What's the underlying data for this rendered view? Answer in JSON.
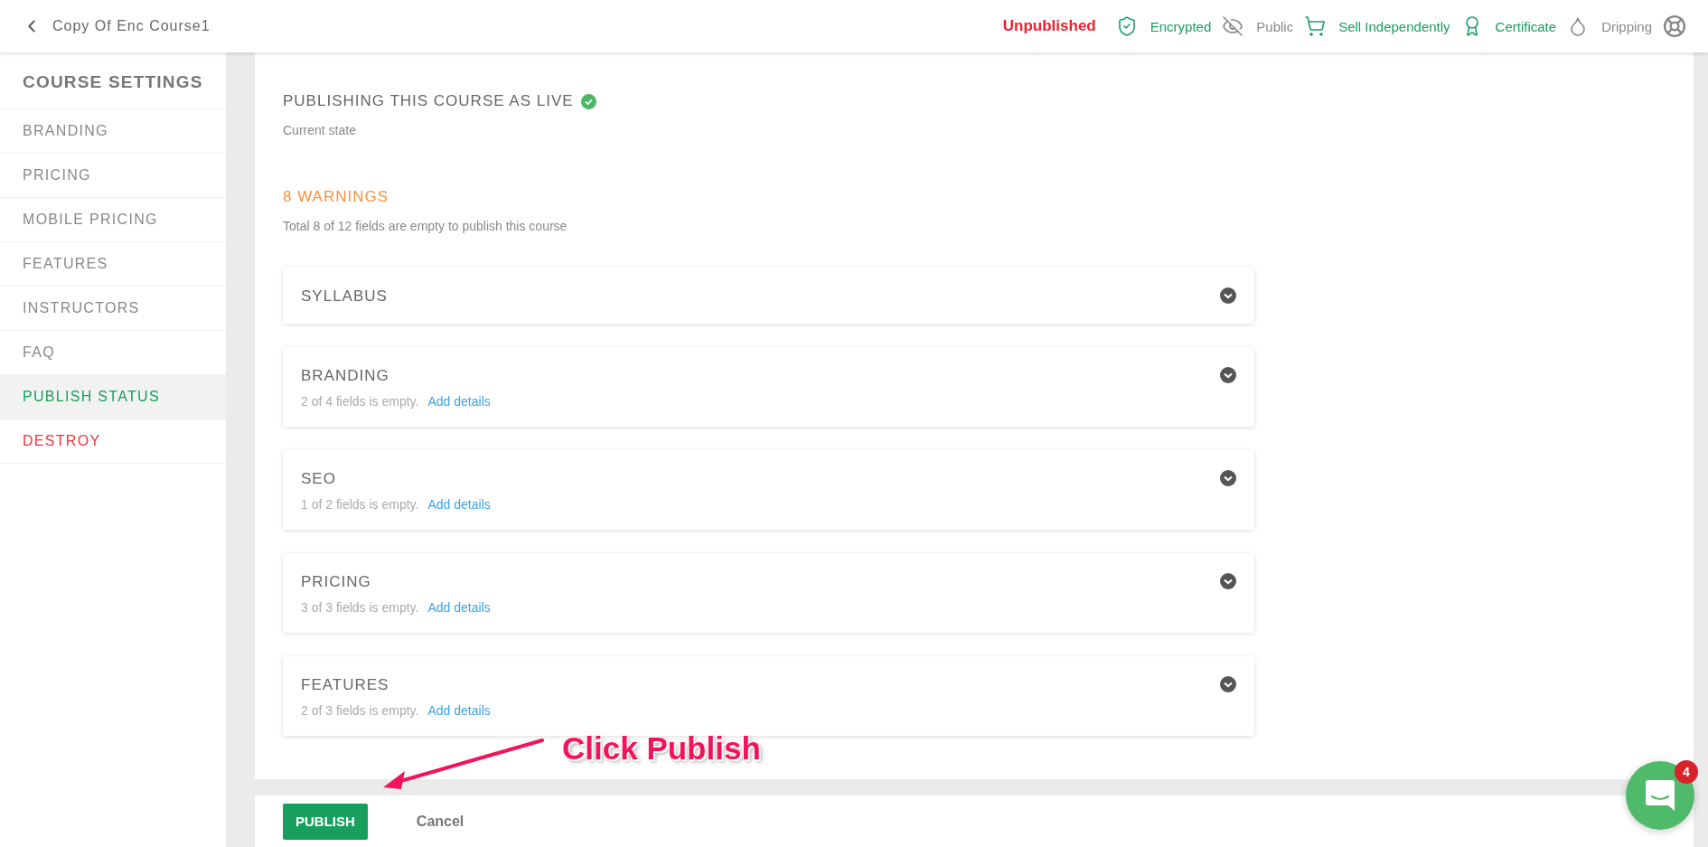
{
  "header": {
    "title": "Copy Of Enc Course1",
    "status": "Unpublished",
    "badges": [
      {
        "kind": "shield",
        "label": "Encrypted",
        "active": true
      },
      {
        "kind": "eye",
        "label": "Public",
        "active": false
      },
      {
        "kind": "cart",
        "label": "Sell Independently",
        "active": true
      },
      {
        "kind": "ribbon",
        "label": "Certificate",
        "active": true
      },
      {
        "kind": "drop",
        "label": "Dripping",
        "active": false
      }
    ]
  },
  "sidebar": {
    "title": "COURSE SETTINGS",
    "items": [
      {
        "label": "BRANDING",
        "selected": false,
        "kind": "normal"
      },
      {
        "label": "PRICING",
        "selected": false,
        "kind": "normal"
      },
      {
        "label": "MOBILE PRICING",
        "selected": false,
        "kind": "normal"
      },
      {
        "label": "FEATURES",
        "selected": false,
        "kind": "normal"
      },
      {
        "label": "INSTRUCTORS",
        "selected": false,
        "kind": "normal"
      },
      {
        "label": "FAQ",
        "selected": false,
        "kind": "normal"
      },
      {
        "label": "PUBLISH STATUS",
        "selected": true,
        "kind": "normal"
      },
      {
        "label": "DESTROY",
        "selected": false,
        "kind": "danger"
      }
    ]
  },
  "publish": {
    "heading": "PUBLISHING THIS COURSE AS LIVE",
    "verified": true,
    "caption": "Current state"
  },
  "warnings": {
    "title": "8 WARNINGS",
    "caption": "Total 8 of 12 fields are empty to publish this course"
  },
  "sections": [
    {
      "title": "SYLLABUS"
    },
    {
      "title": "BRANDING",
      "summary": "2 of 4 fields is empty.",
      "link": "Add details"
    },
    {
      "title": "SEO",
      "summary": "1 of 2 fields is empty.",
      "link": "Add details"
    },
    {
      "title": "PRICING",
      "summary": "3 of 3 fields is empty.",
      "link": "Add details"
    },
    {
      "title": "FEATURES",
      "summary": "2 of 3 fields is empty.",
      "link": "Add details"
    }
  ],
  "footer": {
    "publish": "PUBLISH",
    "cancel": "Cancel"
  },
  "annotation": "Click Publish",
  "chat": {
    "badge": "4"
  }
}
